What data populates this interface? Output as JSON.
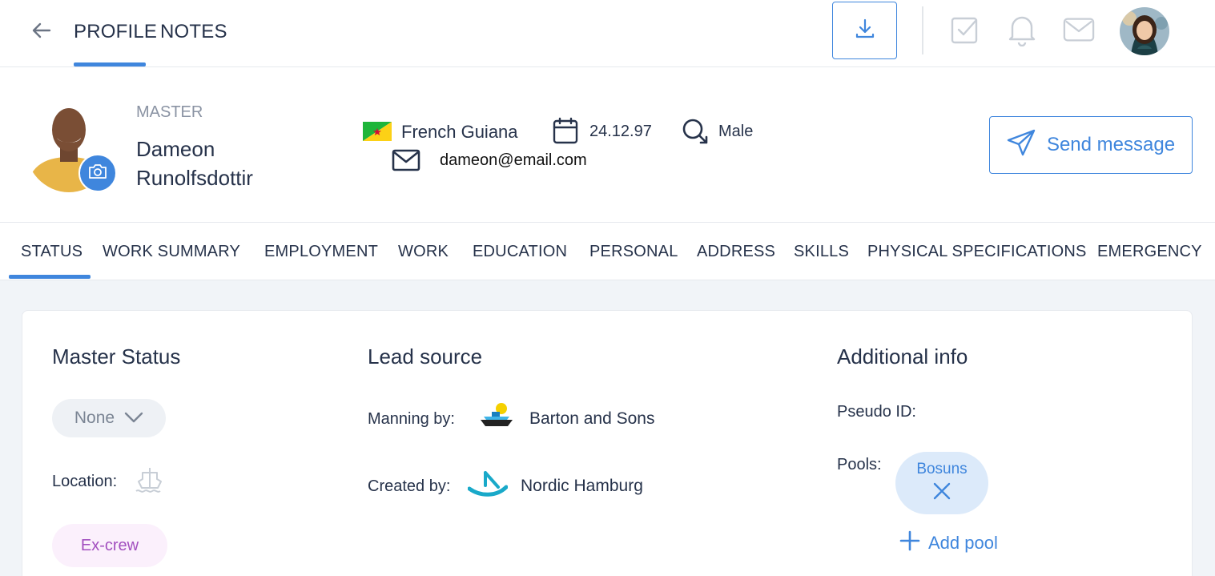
{
  "topbar": {
    "tabs": [
      "PROFILE",
      "NOTES"
    ],
    "active_tab": "PROFILE"
  },
  "profile": {
    "role": "MASTER",
    "first_name": "Dameon",
    "last_name": "Runolfsdottir",
    "country": "French Guiana",
    "birth_date": "24.12.97",
    "gender": "Male",
    "email": "dameon@email.com",
    "send_message_label": "Send message"
  },
  "tabs": {
    "items": [
      "STATUS",
      "WORK SUMMARY",
      "EMPLOYMENT",
      "WORK",
      "EDUCATION",
      "PERSONAL",
      "ADDRESS",
      "SKILLS",
      "PHYSICAL SPECIFICATIONS",
      "EMERGENCY"
    ],
    "active": "STATUS"
  },
  "master_status": {
    "title": "Master Status",
    "select_value": "None",
    "location_label": "Location:",
    "badge": "Ex-crew"
  },
  "lead_source": {
    "title": "Lead source",
    "manning_label": "Manning by:",
    "manning_value": "Barton and Sons",
    "created_label": "Created by:",
    "created_value": "Nordic Hamburg"
  },
  "additional_info": {
    "title": "Additional info",
    "pseudo_id_label": "Pseudo ID:",
    "pools_label": "Pools:",
    "pool": "Bosuns",
    "add_pool_label": "Add pool"
  },
  "colors": {
    "accent": "#3f86dd",
    "text": "#26324a",
    "muted": "#8a93a3",
    "background": "#f1f4f8",
    "excrew_badge_text": "#a24fbf"
  }
}
